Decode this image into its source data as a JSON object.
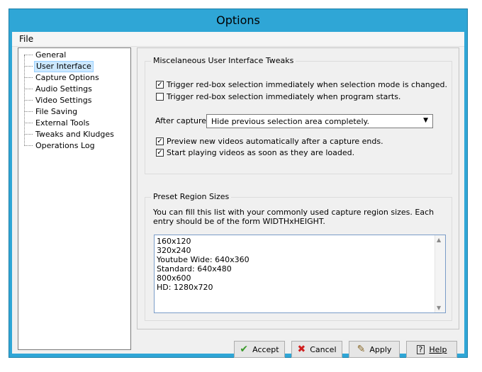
{
  "window": {
    "title": "Options"
  },
  "menu": {
    "file": "File"
  },
  "tree": {
    "items": [
      {
        "label": "General",
        "selected": false
      },
      {
        "label": "User Interface",
        "selected": true
      },
      {
        "label": "Capture Options",
        "selected": false
      },
      {
        "label": "Audio Settings",
        "selected": false
      },
      {
        "label": "Video Settings",
        "selected": false
      },
      {
        "label": "File Saving",
        "selected": false
      },
      {
        "label": "External Tools",
        "selected": false
      },
      {
        "label": "Tweaks and Kludges",
        "selected": false
      },
      {
        "label": "Operations Log",
        "selected": false
      }
    ]
  },
  "misc": {
    "title": "Miscelaneous User Interface Tweaks",
    "check1": {
      "label": "Trigger red-box selection immediately when selection mode is changed.",
      "checked": true
    },
    "check2": {
      "label": "Trigger red-box selection immediately when program starts.",
      "checked": false
    },
    "after_capture": {
      "label": "After capture:",
      "value": "Hide previous selection area completely."
    },
    "check3": {
      "label": "Preview new videos automatically after a capture ends.",
      "checked": true
    },
    "check4": {
      "label": "Start playing videos as soon as they are loaded.",
      "checked": true
    }
  },
  "preset": {
    "title": "Preset Region Sizes",
    "description": "You can fill this list with your commonly used capture region sizes.  Each entry should be of the form WIDTHxHEIGHT.",
    "entries": [
      "160x120",
      "320x240",
      "Youtube Wide: 640x360",
      "Standard: 640x480",
      "800x600",
      "HD: 1280x720"
    ]
  },
  "buttons": {
    "accept": "Accept",
    "cancel": "Cancel",
    "apply": "Apply",
    "help": "Help"
  },
  "colors": {
    "title_bar": "#2fa6d6",
    "client_bg": "#f0f0f0",
    "selection": "#cce8ff"
  }
}
